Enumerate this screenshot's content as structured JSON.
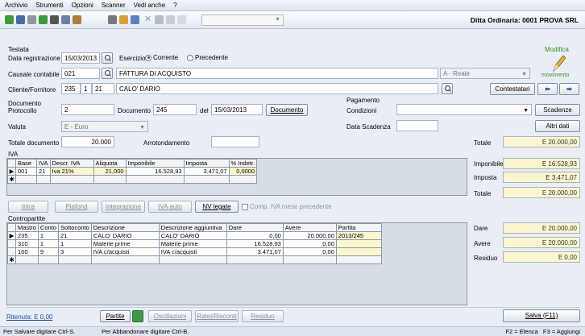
{
  "menu": [
    "Archivio",
    "Strumenti",
    "Opzioni",
    "Scanner",
    "Vedi anche",
    "?"
  ],
  "company": "Ditta Ordinaria: 0001 PROVA SRL",
  "modify": {
    "line1": "Modifica",
    "line2": "movimento"
  },
  "testata": {
    "section": "Testata",
    "data_reg_label": "Data registrazione",
    "data_reg": "15/03/2013",
    "esercizio_label": "Esercizio",
    "corrente": "Corrente",
    "precedente": "Precedente",
    "causale_label": "Causale contabile",
    "causale_code": "021",
    "causale_desc": "FATTURA DI ACQUISTO",
    "causale_type": "A - Reale",
    "cliente_label": "Cliente/Fornitore",
    "cf_1": "235",
    "cf_2": "1",
    "cf_3": "21",
    "cf_desc": "CALO' DARIO",
    "contestatari": "Contestatari"
  },
  "documento": {
    "section": "Documento",
    "protocollo_label": "Protocollo",
    "protocollo": "2",
    "documento_label": "Documento",
    "documento": "245",
    "del_label": "del",
    "del": "15/03/2013",
    "documento_btn": "Documento",
    "valuta_label": "Valuta",
    "valuta": "E - Euro",
    "totale_label": "Totale documento",
    "totale": "20.000",
    "arrot_label": "Arrotondamento",
    "arrot": ""
  },
  "pagamento": {
    "section": "Pagamento",
    "condizioni_label": "Condizioni",
    "condizioni": "",
    "scadenze": "Scadenze",
    "data_scad_label": "Data Scadenza",
    "data_scad": "",
    "altri_dati": "Altri dati"
  },
  "summary_top": {
    "totale_label": "Totale",
    "totale": "E 20.000,00"
  },
  "iva": {
    "section": "IVA",
    "headers": [
      "Base",
      "IVA",
      "Descr. IVA",
      "Aliquota",
      "Imponibile",
      "Imposta",
      "% Indetr."
    ],
    "rows": [
      [
        "001",
        "21",
        "Iva 21%",
        "21,000",
        "16.528,93",
        "3.471,07",
        "0,0000"
      ]
    ],
    "imponibile_label": "Imponibile",
    "imponibile": "E 16.528,93",
    "imposta_label": "Imposta",
    "imposta": "E 3.471,07",
    "totale_label": "Totale",
    "totale": "E 20.000,00"
  },
  "iva_buttons": {
    "intra": "Intra",
    "plafond": "Plafond",
    "integrazione": "Integrazione",
    "iva_auto": "IVA auto",
    "nv_legate": "NV legate",
    "comp_iva": "Comp. IVA mese precedente"
  },
  "contropartite": {
    "section": "Contropartite",
    "headers": [
      "Mastro",
      "Conto",
      "Sottoconto",
      "Descrizione",
      "Descrizione aggiuntiva",
      "Dare",
      "Avere",
      "Partita"
    ],
    "rows": [
      [
        "235",
        "1",
        "21",
        "CALO' DARIO",
        "CALO' DARIO",
        "0,00",
        "20.000,00",
        "2013/245"
      ],
      [
        "310",
        "1",
        "1",
        "Materie prime",
        "Materie prime",
        "16.528,93",
        "0,00",
        ""
      ],
      [
        "160",
        "9",
        "3",
        "IVA c/acquisti",
        "IVA c/acquisti",
        "3.471,07",
        "0,00",
        ""
      ]
    ],
    "dare_label": "Dare",
    "dare": "E 20.000,00",
    "avere_label": "Avere",
    "avere": "E 20.000,00",
    "residuo_label": "Residuo",
    "residuo": "E 0,00"
  },
  "bottom": {
    "ritenuta": "Ritenuta: E 0,00",
    "partite": "Partite",
    "oscillazioni": "Oscillazioni",
    "ratei": "Ratei/Risconti",
    "residuo": "Residuo",
    "salva": "Salva (F11)"
  },
  "status": {
    "left1": "Per Salvare digitare Ctrl-S.",
    "left2": "Per Abbandonare digitare Ctrl-B.",
    "right": "F2 = Elenca   F3 = Aggiungi"
  }
}
